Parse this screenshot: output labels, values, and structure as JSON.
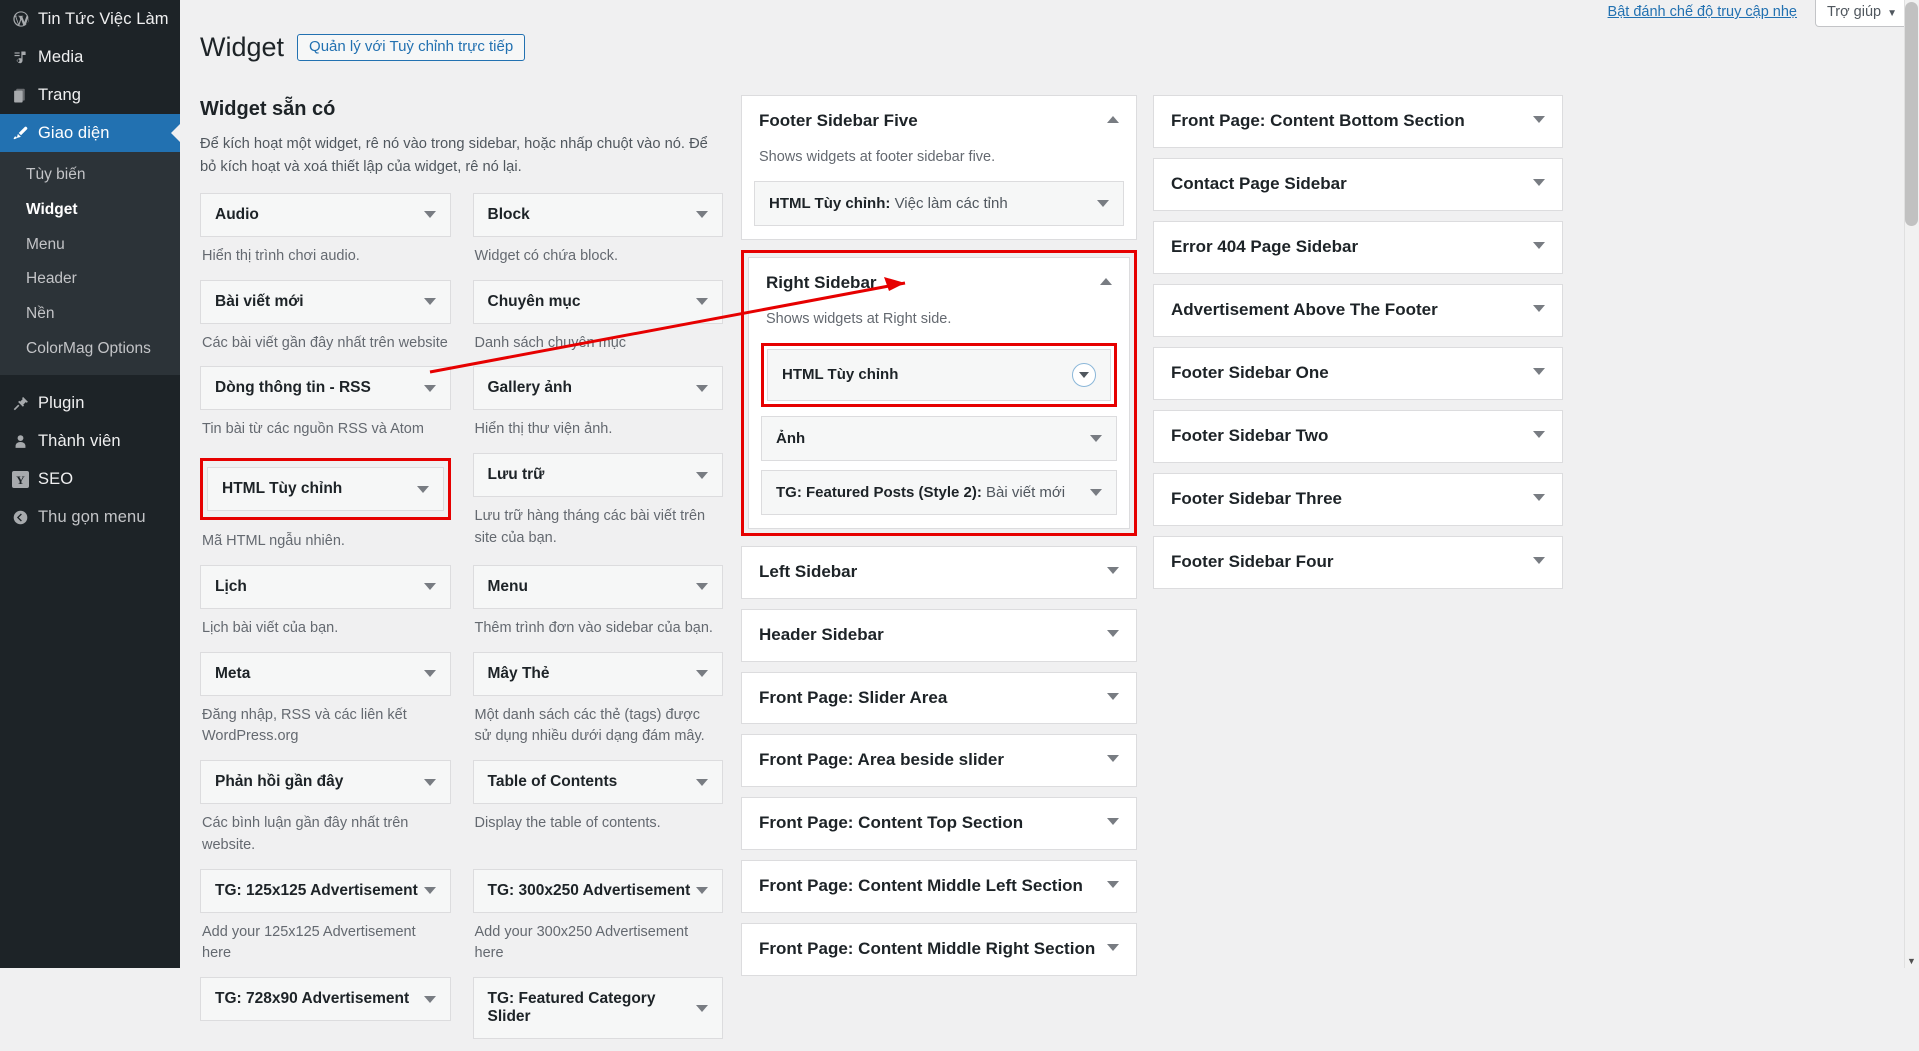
{
  "admin_menu": {
    "items": [
      {
        "label": "Tin Tức Việc Làm",
        "icon": "wordpress-site-icon",
        "name": "site-name"
      },
      {
        "label": "Media",
        "icon": "media-icon",
        "name": "media"
      },
      {
        "label": "Trang",
        "icon": "pages-icon",
        "name": "pages"
      },
      {
        "label": "Giao diện",
        "icon": "appearance-brush-icon",
        "name": "appearance",
        "current": true
      },
      {
        "label": "Plugin",
        "icon": "plugin-plug-icon",
        "name": "plugins"
      },
      {
        "label": "Thành viên",
        "icon": "users-person-icon",
        "name": "users"
      },
      {
        "label": "SEO",
        "icon": "yoast-seo-icon",
        "name": "seo"
      },
      {
        "label": "Thu gọn menu",
        "icon": "collapse-arrow-icon",
        "name": "collapse-menu"
      }
    ],
    "appearance_submenu": [
      {
        "label": "Tùy biến",
        "name": "customize"
      },
      {
        "label": "Widget",
        "name": "widgets",
        "current": true
      },
      {
        "label": "Menu",
        "name": "menus"
      },
      {
        "label": "Header",
        "name": "header"
      },
      {
        "label": "Nền",
        "name": "background"
      },
      {
        "label": "ColorMag Options",
        "name": "colormag-options"
      }
    ]
  },
  "topbar": {
    "accessibility_link": "Bật đánh chế độ truy cập nhẹ",
    "help_label": "Trợ giúp",
    "help_caret": "▼"
  },
  "header": {
    "title": "Widget",
    "manage_button": "Quản lý với Tuỳ chỉnh trực tiếp"
  },
  "available": {
    "section_title": "Widget sẵn có",
    "section_desc": "Để kích hoạt một widget, rê nó vào trong sidebar, hoặc nhấp chuột vào nó. Để bỏ kích hoạt và xoá thiết lập của widget, rê nó lại.",
    "widgets_left": [
      {
        "name": "Audio",
        "desc": "Hiển thị trình chơi audio.",
        "highlighted": false
      },
      {
        "name": "Bài viết mới",
        "desc": "Các bài viết gần đây nhất trên website",
        "highlighted": false
      },
      {
        "name": "Dòng thông tin - RSS",
        "desc": "Tin bài từ các nguồn RSS và Atom",
        "highlighted": false
      },
      {
        "name": "HTML Tùy chỉnh",
        "desc": "Mã HTML ngẫu nhiên.",
        "highlighted": true
      },
      {
        "name": "Lịch",
        "desc": "Lịch bài viết của bạn.",
        "highlighted": false
      },
      {
        "name": "Meta",
        "desc": "Đăng nhập, RSS và các liên kết WordPress.org",
        "highlighted": false
      },
      {
        "name": "Phản hồi gần đây",
        "desc": "Các bình luận gần đây nhất trên website.",
        "highlighted": false
      },
      {
        "name": "TG: 125x125 Advertisement",
        "desc": "Add your 125x125 Advertisement here",
        "highlighted": false
      },
      {
        "name": "TG: 728x90 Advertisement",
        "desc": "",
        "highlighted": false
      }
    ],
    "widgets_right": [
      {
        "name": "Block",
        "desc": "Widget có chứa block.",
        "highlighted": false
      },
      {
        "name": "Chuyên mục",
        "desc": "Danh sách chuyên mục",
        "highlighted": false
      },
      {
        "name": "Gallery ảnh",
        "desc": "Hiển thị thư viện ảnh.",
        "highlighted": false
      },
      {
        "name": "Lưu trữ",
        "desc": "Lưu trữ hàng tháng các bài viết trên site của bạn.",
        "highlighted": false
      },
      {
        "name": "Menu",
        "desc": "Thêm trình đơn vào sidebar của bạn.",
        "highlighted": false
      },
      {
        "name": "Mây Thẻ",
        "desc": "Một danh sách các thẻ (tags) được sử dụng nhiều dưới dạng đám mây.",
        "highlighted": false
      },
      {
        "name": "Table of Contents",
        "desc": "Display the table of contents.",
        "highlighted": false
      },
      {
        "name": "TG: 300x250 Advertisement",
        "desc": "Add your 300x250 Advertisement here",
        "highlighted": false
      },
      {
        "name": "TG: Featured Category Slider",
        "desc": "",
        "highlighted": false
      }
    ]
  },
  "sidebars_column_middle": [
    {
      "title": "Footer Sidebar Five",
      "desc": "Shows widgets at footer sidebar five.",
      "expanded": true,
      "highlighted": false,
      "toggle": "collapse",
      "widgets": [
        {
          "label": "HTML Tùy chỉnh:",
          "instance": "Việc làm các tỉnh",
          "highlighted": false,
          "toggle": "caret"
        }
      ]
    },
    {
      "title": "Right Sidebar",
      "desc": "Shows widgets at Right side.",
      "expanded": true,
      "highlighted": true,
      "toggle": "collapse",
      "widgets": [
        {
          "label": "HTML Tùy chỉnh",
          "instance": "",
          "highlighted": true,
          "toggle": "circle"
        },
        {
          "label": "Ảnh",
          "instance": "",
          "highlighted": false,
          "toggle": "caret"
        },
        {
          "label": "TG: Featured Posts (Style 2):",
          "instance": "Bài viết mới",
          "highlighted": false,
          "toggle": "caret"
        }
      ]
    },
    {
      "title": "Left Sidebar",
      "desc": "",
      "expanded": false,
      "highlighted": false,
      "toggle": "caret",
      "widgets": []
    },
    {
      "title": "Header Sidebar",
      "desc": "",
      "expanded": false,
      "highlighted": false,
      "toggle": "caret",
      "widgets": []
    },
    {
      "title": "Front Page: Slider Area",
      "desc": "",
      "expanded": false,
      "highlighted": false,
      "toggle": "caret",
      "widgets": []
    },
    {
      "title": "Front Page: Area beside slider",
      "desc": "",
      "expanded": false,
      "highlighted": false,
      "toggle": "caret",
      "widgets": []
    },
    {
      "title": "Front Page: Content Top Section",
      "desc": "",
      "expanded": false,
      "highlighted": false,
      "toggle": "caret",
      "widgets": []
    },
    {
      "title": "Front Page: Content Middle Left Section",
      "desc": "",
      "expanded": false,
      "highlighted": false,
      "toggle": "caret",
      "widgets": []
    },
    {
      "title": "Front Page: Content Middle Right Section",
      "desc": "",
      "expanded": false,
      "highlighted": false,
      "toggle": "caret",
      "widgets": []
    }
  ],
  "sidebars_column_right": [
    {
      "title": "Front Page: Content Bottom Section",
      "desc": "",
      "expanded": false,
      "highlighted": false,
      "toggle": "caret",
      "widgets": []
    },
    {
      "title": "Contact Page Sidebar",
      "desc": "",
      "expanded": false,
      "highlighted": false,
      "toggle": "caret",
      "widgets": []
    },
    {
      "title": "Error 404 Page Sidebar",
      "desc": "",
      "expanded": false,
      "highlighted": false,
      "toggle": "caret",
      "widgets": []
    },
    {
      "title": "Advertisement Above The Footer",
      "desc": "",
      "expanded": false,
      "highlighted": false,
      "toggle": "caret",
      "widgets": []
    },
    {
      "title": "Footer Sidebar One",
      "desc": "",
      "expanded": false,
      "highlighted": false,
      "toggle": "caret",
      "widgets": []
    },
    {
      "title": "Footer Sidebar Two",
      "desc": "",
      "expanded": false,
      "highlighted": false,
      "toggle": "caret",
      "widgets": []
    },
    {
      "title": "Footer Sidebar Three",
      "desc": "",
      "expanded": false,
      "highlighted": false,
      "toggle": "caret",
      "widgets": []
    },
    {
      "title": "Footer Sidebar Four",
      "desc": "",
      "expanded": false,
      "highlighted": false,
      "toggle": "caret",
      "widgets": []
    }
  ],
  "annotation": {
    "color": "#e60000",
    "description": "Red arrow pointing from the available HTML Tùy chỉnh widget to the HTML Tùy chỉnh widget placed in Right Sidebar"
  },
  "colors": {
    "admin_menu_bg": "#1d2327",
    "admin_menu_current": "#2271b1",
    "page_bg": "#f0f0f1",
    "panel_bg": "#ffffff",
    "widget_bg": "#f6f7f7",
    "border": "#dcdcde",
    "link": "#2271b1",
    "annotation": "#e60000"
  }
}
